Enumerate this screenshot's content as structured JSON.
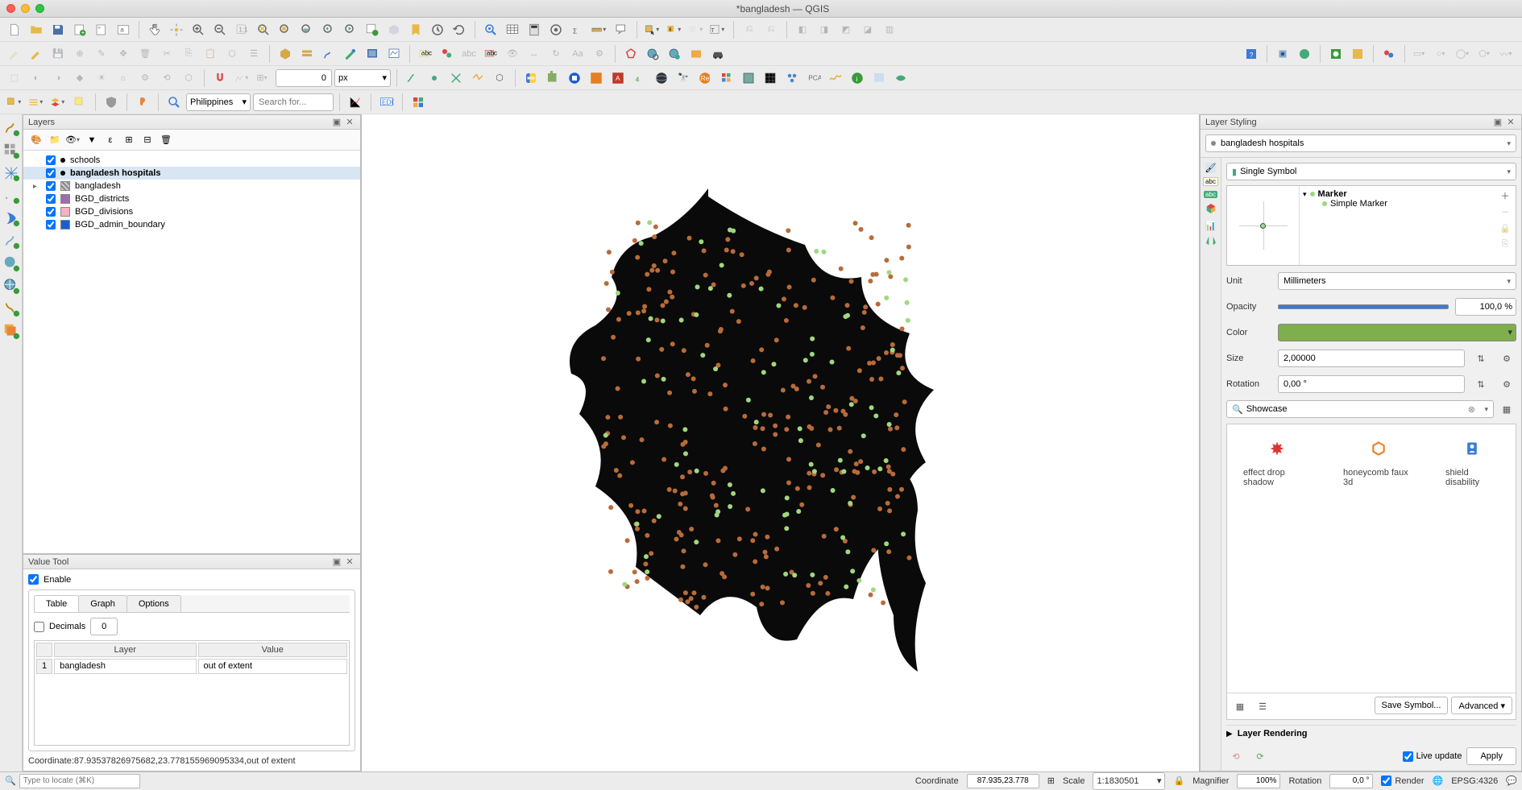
{
  "window": {
    "title": "*bangladesh — QGIS"
  },
  "toolbar_row4": {
    "region": "Philippines",
    "search_placeholder": "Search for..."
  },
  "snap_input": {
    "value": "0",
    "unit": "px"
  },
  "layers_panel": {
    "title": "Layers",
    "items": [
      {
        "checked": true,
        "label": "schools",
        "swatch_type": "dot",
        "color": "#000"
      },
      {
        "checked": true,
        "label": "bangladesh hospitals",
        "swatch_type": "dot",
        "color": "#000",
        "bold": true,
        "selected": true
      },
      {
        "checked": true,
        "label": "bangladesh",
        "swatch_type": "raster",
        "color": "#888",
        "expandable": true
      },
      {
        "checked": true,
        "label": "BGD_districts",
        "swatch_type": "square",
        "color": "#9b6fa8"
      },
      {
        "checked": true,
        "label": "BGD_divisions",
        "swatch_type": "square",
        "color": "#f5b2c2"
      },
      {
        "checked": true,
        "label": "BGD_admin_boundary",
        "swatch_type": "square",
        "color": "#1a5fd0"
      }
    ]
  },
  "value_tool": {
    "title": "Value Tool",
    "enable": "Enable",
    "tabs": [
      "Table",
      "Graph",
      "Options"
    ],
    "decimals_label": "Decimals",
    "decimals_value": "0",
    "headers": [
      "Layer",
      "Value"
    ],
    "row_idx": "1",
    "row_layer": "bangladesh",
    "row_value": "out of extent",
    "coord_line": "Coordinate:87.93537826975682,23.778155969095334,out of extent"
  },
  "layer_styling": {
    "title": "Layer Styling",
    "layer_name": "bangladesh hospitals",
    "renderer": "Single Symbol",
    "tree": {
      "root": "Marker",
      "child": "Simple Marker"
    },
    "unit_label": "Unit",
    "unit_value": "Millimeters",
    "opacity_label": "Opacity",
    "opacity_value": "100,0 %",
    "color_label": "Color",
    "color_value": "#7fae4d",
    "size_label": "Size",
    "size_value": "2,00000",
    "rotation_label": "Rotation",
    "rotation_value": "0,00 °",
    "search_value": "Showcase",
    "showcase": [
      {
        "label": "effect drop shadow",
        "icon": "starburst"
      },
      {
        "label": "honeycomb faux 3d",
        "icon": "hexagon"
      },
      {
        "label": "shield disability",
        "icon": "shield"
      }
    ],
    "save_symbol": "Save Symbol...",
    "advanced": "Advanced",
    "layer_rendering": "Layer Rendering",
    "live_update": "Live update",
    "apply": "Apply"
  },
  "statusbar": {
    "locator_placeholder": "Type to locate (⌘K)",
    "coord_label": "Coordinate",
    "coord_value": "87.935,23.778",
    "scale_label": "Scale",
    "scale_value": "1:1830501",
    "magnifier_label": "Magnifier",
    "magnifier_value": "100%",
    "rotation_label": "Rotation",
    "rotation_value": "0,0 °",
    "render_label": "Render",
    "crs": "EPSG:4326"
  }
}
